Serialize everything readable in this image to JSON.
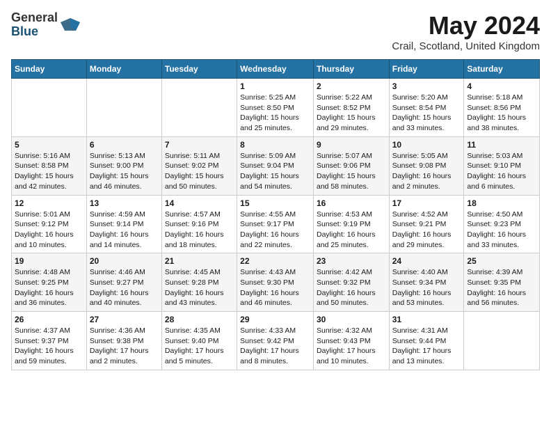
{
  "header": {
    "logo_general": "General",
    "logo_blue": "Blue",
    "month_year": "May 2024",
    "location": "Crail, Scotland, United Kingdom"
  },
  "days_of_week": [
    "Sunday",
    "Monday",
    "Tuesday",
    "Wednesday",
    "Thursday",
    "Friday",
    "Saturday"
  ],
  "weeks": [
    [
      {
        "day": "",
        "info": ""
      },
      {
        "day": "",
        "info": ""
      },
      {
        "day": "",
        "info": ""
      },
      {
        "day": "1",
        "info": "Sunrise: 5:25 AM\nSunset: 8:50 PM\nDaylight: 15 hours\nand 25 minutes."
      },
      {
        "day": "2",
        "info": "Sunrise: 5:22 AM\nSunset: 8:52 PM\nDaylight: 15 hours\nand 29 minutes."
      },
      {
        "day": "3",
        "info": "Sunrise: 5:20 AM\nSunset: 8:54 PM\nDaylight: 15 hours\nand 33 minutes."
      },
      {
        "day": "4",
        "info": "Sunrise: 5:18 AM\nSunset: 8:56 PM\nDaylight: 15 hours\nand 38 minutes."
      }
    ],
    [
      {
        "day": "5",
        "info": "Sunrise: 5:16 AM\nSunset: 8:58 PM\nDaylight: 15 hours\nand 42 minutes."
      },
      {
        "day": "6",
        "info": "Sunrise: 5:13 AM\nSunset: 9:00 PM\nDaylight: 15 hours\nand 46 minutes."
      },
      {
        "day": "7",
        "info": "Sunrise: 5:11 AM\nSunset: 9:02 PM\nDaylight: 15 hours\nand 50 minutes."
      },
      {
        "day": "8",
        "info": "Sunrise: 5:09 AM\nSunset: 9:04 PM\nDaylight: 15 hours\nand 54 minutes."
      },
      {
        "day": "9",
        "info": "Sunrise: 5:07 AM\nSunset: 9:06 PM\nDaylight: 15 hours\nand 58 minutes."
      },
      {
        "day": "10",
        "info": "Sunrise: 5:05 AM\nSunset: 9:08 PM\nDaylight: 16 hours\nand 2 minutes."
      },
      {
        "day": "11",
        "info": "Sunrise: 5:03 AM\nSunset: 9:10 PM\nDaylight: 16 hours\nand 6 minutes."
      }
    ],
    [
      {
        "day": "12",
        "info": "Sunrise: 5:01 AM\nSunset: 9:12 PM\nDaylight: 16 hours\nand 10 minutes."
      },
      {
        "day": "13",
        "info": "Sunrise: 4:59 AM\nSunset: 9:14 PM\nDaylight: 16 hours\nand 14 minutes."
      },
      {
        "day": "14",
        "info": "Sunrise: 4:57 AM\nSunset: 9:16 PM\nDaylight: 16 hours\nand 18 minutes."
      },
      {
        "day": "15",
        "info": "Sunrise: 4:55 AM\nSunset: 9:17 PM\nDaylight: 16 hours\nand 22 minutes."
      },
      {
        "day": "16",
        "info": "Sunrise: 4:53 AM\nSunset: 9:19 PM\nDaylight: 16 hours\nand 25 minutes."
      },
      {
        "day": "17",
        "info": "Sunrise: 4:52 AM\nSunset: 9:21 PM\nDaylight: 16 hours\nand 29 minutes."
      },
      {
        "day": "18",
        "info": "Sunrise: 4:50 AM\nSunset: 9:23 PM\nDaylight: 16 hours\nand 33 minutes."
      }
    ],
    [
      {
        "day": "19",
        "info": "Sunrise: 4:48 AM\nSunset: 9:25 PM\nDaylight: 16 hours\nand 36 minutes."
      },
      {
        "day": "20",
        "info": "Sunrise: 4:46 AM\nSunset: 9:27 PM\nDaylight: 16 hours\nand 40 minutes."
      },
      {
        "day": "21",
        "info": "Sunrise: 4:45 AM\nSunset: 9:28 PM\nDaylight: 16 hours\nand 43 minutes."
      },
      {
        "day": "22",
        "info": "Sunrise: 4:43 AM\nSunset: 9:30 PM\nDaylight: 16 hours\nand 46 minutes."
      },
      {
        "day": "23",
        "info": "Sunrise: 4:42 AM\nSunset: 9:32 PM\nDaylight: 16 hours\nand 50 minutes."
      },
      {
        "day": "24",
        "info": "Sunrise: 4:40 AM\nSunset: 9:34 PM\nDaylight: 16 hours\nand 53 minutes."
      },
      {
        "day": "25",
        "info": "Sunrise: 4:39 AM\nSunset: 9:35 PM\nDaylight: 16 hours\nand 56 minutes."
      }
    ],
    [
      {
        "day": "26",
        "info": "Sunrise: 4:37 AM\nSunset: 9:37 PM\nDaylight: 16 hours\nand 59 minutes."
      },
      {
        "day": "27",
        "info": "Sunrise: 4:36 AM\nSunset: 9:38 PM\nDaylight: 17 hours\nand 2 minutes."
      },
      {
        "day": "28",
        "info": "Sunrise: 4:35 AM\nSunset: 9:40 PM\nDaylight: 17 hours\nand 5 minutes."
      },
      {
        "day": "29",
        "info": "Sunrise: 4:33 AM\nSunset: 9:42 PM\nDaylight: 17 hours\nand 8 minutes."
      },
      {
        "day": "30",
        "info": "Sunrise: 4:32 AM\nSunset: 9:43 PM\nDaylight: 17 hours\nand 10 minutes."
      },
      {
        "day": "31",
        "info": "Sunrise: 4:31 AM\nSunset: 9:44 PM\nDaylight: 17 hours\nand 13 minutes."
      },
      {
        "day": "",
        "info": ""
      }
    ]
  ]
}
